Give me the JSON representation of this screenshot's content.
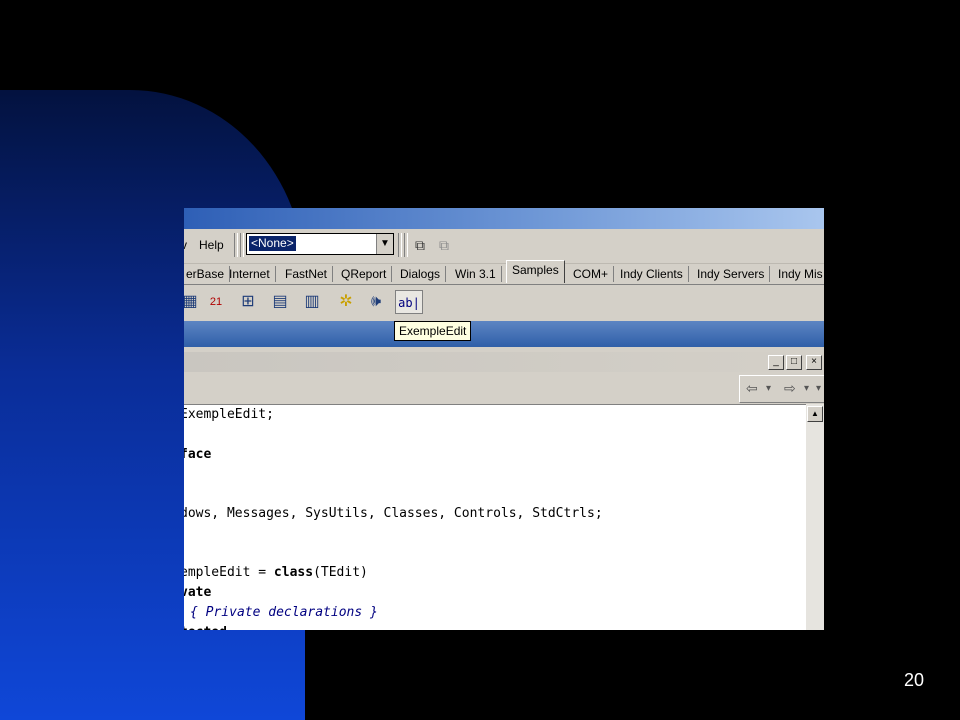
{
  "page_number": "20",
  "menu": {
    "partial_item": "v",
    "help": "Help"
  },
  "combo": {
    "value": "<None>",
    "arrow": "▼"
  },
  "toolbar_icons": [
    "form-list-icon",
    "units-list-icon"
  ],
  "component_tabs": [
    "erBase",
    "Internet",
    "FastNet",
    "QReport",
    "Dialogs",
    "Win 3.1",
    "Samples",
    "COM+",
    "Indy Clients",
    "Indy Servers",
    "Indy Mis"
  ],
  "active_tab": "Samples",
  "palette_icons": [
    {
      "name": "gauge-component-icon",
      "glyph": "▦"
    },
    {
      "name": "calendar-component-icon",
      "glyph": "21"
    },
    {
      "name": "directory-outline-icon",
      "glyph": "⊞"
    },
    {
      "name": "color-grid-icon",
      "glyph": "▤"
    },
    {
      "name": "spin-edit-icon",
      "glyph": "▥"
    },
    {
      "name": "sparkle-component-icon",
      "glyph": "✲"
    },
    {
      "name": "speaker-component-icon",
      "glyph": "🕪"
    },
    {
      "name": "exemple-edit-icon",
      "glyph": "ab|"
    }
  ],
  "tooltip": "ExempleEdit",
  "window_buttons": {
    "minimize": "_",
    "maximize": "□",
    "close": "×"
  },
  "nav": {
    "back": "⇦",
    "back_dropdown": "▾",
    "forward": "⇨",
    "forward_dropdown": "▾",
    "more": "▾"
  },
  "code_lines": [
    [
      {
        "t": "ExempleEdit;",
        "k": false
      }
    ],
    [
      {
        "t": "face",
        "k": true
      }
    ],
    [
      {
        "t": "dows, Messages, SysUtils, Classes, Controls, StdCtrls;",
        "k": false
      }
    ],
    [
      {
        "t": "empleEdit = ",
        "k": false
      },
      {
        "t": "class",
        "k": true
      },
      {
        "t": "(TEdit)",
        "k": false
      }
    ],
    [
      {
        "t": "vate",
        "k": true
      }
    ],
    [
      {
        "t": "{ Private declarations }",
        "k": false,
        "c": true
      }
    ],
    [
      {
        "t": "tected",
        "k": true
      }
    ]
  ],
  "scroll_up": "▲"
}
